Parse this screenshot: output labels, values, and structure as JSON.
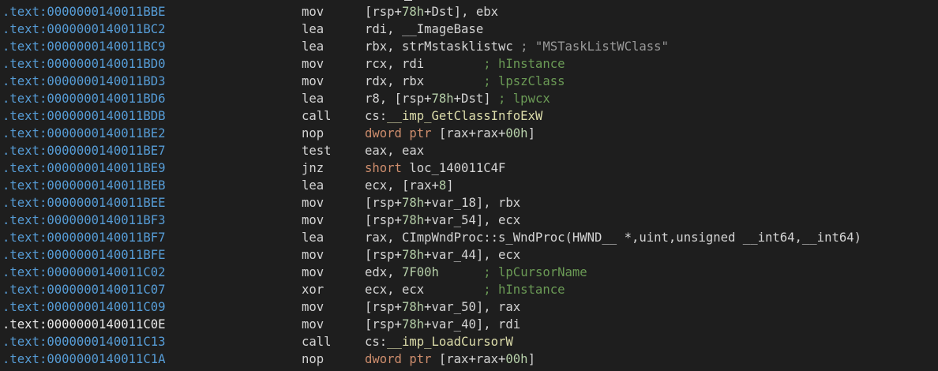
{
  "colors": {
    "background": "#1e1e1e",
    "address": "#569cd6",
    "address_selected": "#e8e8e8",
    "text": "#d4d4d4",
    "number": "#b5cea8",
    "keyword": "#cf8e6d",
    "function": "#dcdcaa",
    "comment": "#6a9955",
    "string": "#ce9178",
    "gray": "#9a9a9a"
  },
  "rows": [
    {
      "address": ".text:0000000140011BBE",
      "mnemonic": "mov",
      "operands": [
        {
          "t": "[rsp+",
          "c": "t-n"
        },
        {
          "t": "78h",
          "c": "t-num"
        },
        {
          "t": "+Dst], ebx",
          "c": "t-n"
        }
      ]
    },
    {
      "address": ".text:0000000140011BC2",
      "mnemonic": "lea",
      "operands": [
        {
          "t": "rdi, __ImageBase",
          "c": "t-n"
        }
      ]
    },
    {
      "address": ".text:0000000140011BC9",
      "mnemonic": "lea",
      "operands": [
        {
          "t": "rbx, strMstasklistwc",
          "c": "t-n"
        },
        {
          "t": " ; \"MSTaskListWClass\"",
          "c": "t-gr"
        }
      ]
    },
    {
      "address": ".text:0000000140011BD0",
      "mnemonic": "mov",
      "operands": [
        {
          "t": "rcx, rdi        ",
          "c": "t-n"
        },
        {
          "t": "; hInstance",
          "c": "t-cm"
        }
      ]
    },
    {
      "address": ".text:0000000140011BD3",
      "mnemonic": "mov",
      "operands": [
        {
          "t": "rdx, rbx        ",
          "c": "t-n"
        },
        {
          "t": "; lpszClass",
          "c": "t-cm"
        }
      ]
    },
    {
      "address": ".text:0000000140011BD6",
      "mnemonic": "lea",
      "operands": [
        {
          "t": "r8, [rsp+",
          "c": "t-n"
        },
        {
          "t": "78h",
          "c": "t-num"
        },
        {
          "t": "+Dst] ",
          "c": "t-n"
        },
        {
          "t": "; lpwcx",
          "c": "t-cm"
        }
      ]
    },
    {
      "address": ".text:0000000140011BDB",
      "mnemonic": "call",
      "operands": [
        {
          "t": "cs:",
          "c": "t-n"
        },
        {
          "t": "__imp_GetClassInfoExW",
          "c": "t-fn"
        }
      ]
    },
    {
      "address": ".text:0000000140011BE2",
      "mnemonic": "nop",
      "operands": [
        {
          "t": "dword ptr",
          "c": "t-kw"
        },
        {
          "t": " [rax+rax+",
          "c": "t-n"
        },
        {
          "t": "00h",
          "c": "t-num"
        },
        {
          "t": "]",
          "c": "t-n"
        }
      ]
    },
    {
      "address": ".text:0000000140011BE7",
      "mnemonic": "test",
      "operands": [
        {
          "t": "eax, eax",
          "c": "t-n"
        }
      ]
    },
    {
      "address": ".text:0000000140011BE9",
      "mnemonic": "jnz",
      "operands": [
        {
          "t": "short",
          "c": "t-kw"
        },
        {
          "t": " loc_140011C4F",
          "c": "t-n"
        }
      ]
    },
    {
      "address": ".text:0000000140011BEB",
      "mnemonic": "lea",
      "operands": [
        {
          "t": "ecx, [rax+",
          "c": "t-n"
        },
        {
          "t": "8",
          "c": "t-num"
        },
        {
          "t": "]",
          "c": "t-n"
        }
      ]
    },
    {
      "address": ".text:0000000140011BEE",
      "mnemonic": "mov",
      "operands": [
        {
          "t": "[rsp+",
          "c": "t-n"
        },
        {
          "t": "78h",
          "c": "t-num"
        },
        {
          "t": "+var_18], rbx",
          "c": "t-n"
        }
      ]
    },
    {
      "address": ".text:0000000140011BF3",
      "mnemonic": "mov",
      "operands": [
        {
          "t": "[rsp+",
          "c": "t-n"
        },
        {
          "t": "78h",
          "c": "t-num"
        },
        {
          "t": "+var_54], ecx",
          "c": "t-n"
        }
      ]
    },
    {
      "address": ".text:0000000140011BF7",
      "mnemonic": "lea",
      "operands": [
        {
          "t": "rax, CImpWndProc::s_WndProc(HWND__ *,uint,unsigned __int64,__int64)",
          "c": "t-n"
        }
      ]
    },
    {
      "address": ".text:0000000140011BFE",
      "mnemonic": "mov",
      "operands": [
        {
          "t": "[rsp+",
          "c": "t-n"
        },
        {
          "t": "78h",
          "c": "t-num"
        },
        {
          "t": "+var_44], ecx",
          "c": "t-n"
        }
      ]
    },
    {
      "address": ".text:0000000140011C02",
      "mnemonic": "mov",
      "operands": [
        {
          "t": "edx, ",
          "c": "t-n"
        },
        {
          "t": "7F00h",
          "c": "t-num"
        },
        {
          "t": "      ",
          "c": "t-n"
        },
        {
          "t": "; lpCursorName",
          "c": "t-cm"
        }
      ]
    },
    {
      "address": ".text:0000000140011C07",
      "mnemonic": "xor",
      "operands": [
        {
          "t": "ecx, ecx        ",
          "c": "t-n"
        },
        {
          "t": "; hInstance",
          "c": "t-cm"
        }
      ]
    },
    {
      "address": ".text:0000000140011C09",
      "mnemonic": "mov",
      "operands": [
        {
          "t": "[rsp+",
          "c": "t-n"
        },
        {
          "t": "78h",
          "c": "t-num"
        },
        {
          "t": "+var_50], rax",
          "c": "t-n"
        }
      ]
    },
    {
      "address": ".text:0000000140011C0E",
      "mnemonic": "mov",
      "selected": true,
      "operands": [
        {
          "t": "[rsp+",
          "c": "t-n"
        },
        {
          "t": "78h",
          "c": "t-num"
        },
        {
          "t": "+var_40], rdi",
          "c": "t-n"
        }
      ]
    },
    {
      "address": ".text:0000000140011C13",
      "mnemonic": "call",
      "operands": [
        {
          "t": "cs:",
          "c": "t-n"
        },
        {
          "t": "__imp_LoadCursorW",
          "c": "t-fn"
        }
      ]
    },
    {
      "address": ".text:0000000140011C1A",
      "mnemonic": "nop",
      "operands": [
        {
          "t": "dword ptr",
          "c": "t-kw"
        },
        {
          "t": " [rax+rax+",
          "c": "t-n"
        },
        {
          "t": "00h",
          "c": "t-num"
        },
        {
          "t": "]",
          "c": "t-n"
        }
      ]
    }
  ]
}
